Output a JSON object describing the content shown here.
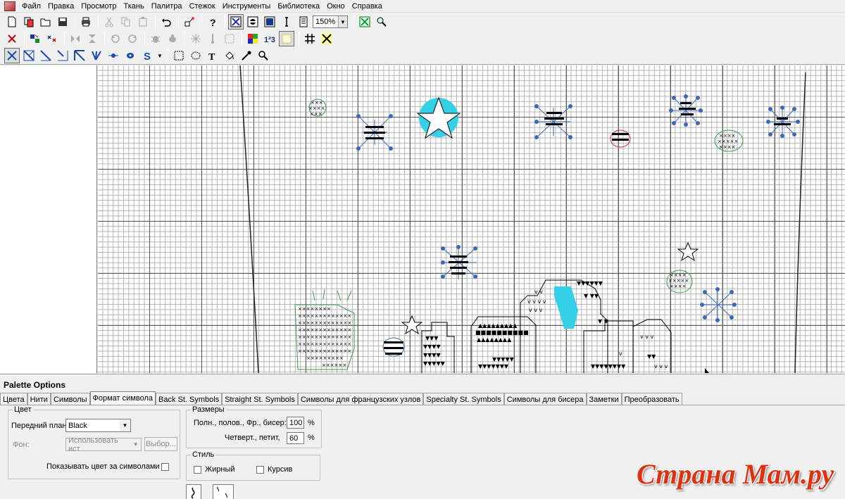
{
  "menu": [
    "Файл",
    "Правка",
    "Просмотр",
    "Ткань",
    "Палитра",
    "Стежок",
    "Инструменты",
    "Библиотека",
    "Окно",
    "Справка"
  ],
  "toolbar1": {
    "zoom_value": "150%",
    "buttons": [
      "new-icon",
      "copy-doc-icon",
      "open-icon",
      "save-icon",
      "print-icon",
      "cut-icon",
      "copy-icon",
      "paste-icon",
      "undo-icon",
      "transform-icon",
      "help-icon",
      "full-stitch-view-icon",
      "symbol-view-icon",
      "color-view-icon",
      "cursor-text-icon",
      "grid-view-icon",
      "fit-icon",
      "zoom-icon"
    ]
  },
  "toolbar2": {
    "buttons": [
      "delete-icon",
      "recolor-icon",
      "replace-icon",
      "flip-h-icon",
      "flip-v-icon",
      "rotate-left-icon",
      "rotate-right-icon",
      "bug-icon",
      "bug2-icon",
      "snowflake-icon",
      "pin-icon",
      "select-rect-icon",
      "palette-grid-icon",
      "numbers-icon",
      "dots-icon",
      "grid-hash-icon",
      "cross-icon"
    ]
  },
  "toolbar3": {
    "buttons": [
      "full-stitch-tool-icon",
      "half-stitch-tool-icon",
      "quarter-stitch-tool-icon",
      "three-quarter-tool-icon",
      "petite-tool-icon",
      "back-stitch-tool-icon",
      "french-knot-tool-icon",
      "bead-tool-icon",
      "specialty-tool-icon",
      "rect-select-icon",
      "lasso-icon",
      "text-tool-icon",
      "fill-tool-icon",
      "eyedropper-icon",
      "magnifier-icon"
    ],
    "special_label": "S"
  },
  "palette": {
    "title": "Palette Options",
    "tabs": [
      "Цвета",
      "Нити",
      "Символы",
      "Формат символа",
      "Back St. Symbols",
      "Straight St. Symbols",
      "Символы для французских узлов",
      "Specialty St. Symbols",
      "Символы для бисера",
      "Заметки",
      "Преобразовать"
    ],
    "active_tab": "Формат символа",
    "color_group": {
      "legend": "Цвет",
      "foreground_label": "Передний план:",
      "foreground_value": "Black",
      "background_label": "Фон:",
      "background_value": "Использовать ист",
      "choose_button": "Выбор...",
      "show_color_label": "Показывать цвет за символами"
    },
    "size_group": {
      "legend": "Размеры",
      "full_label": "Полн., полов., Фр., бисер:",
      "full_value": "100",
      "quarter_label": "Четверт., петит,",
      "quarter_value": "60",
      "percent": "%"
    },
    "style_group": {
      "legend": "Стиль",
      "bold_label": "Жирный",
      "italic_label": "Курсив"
    }
  },
  "watermark": "Страна Мам.ру",
  "colors": {
    "blue_stitch": "#3a6ab5",
    "cyan_fill": "#33d0e8",
    "green_stitch": "#3a9a4a",
    "black": "#000000"
  }
}
